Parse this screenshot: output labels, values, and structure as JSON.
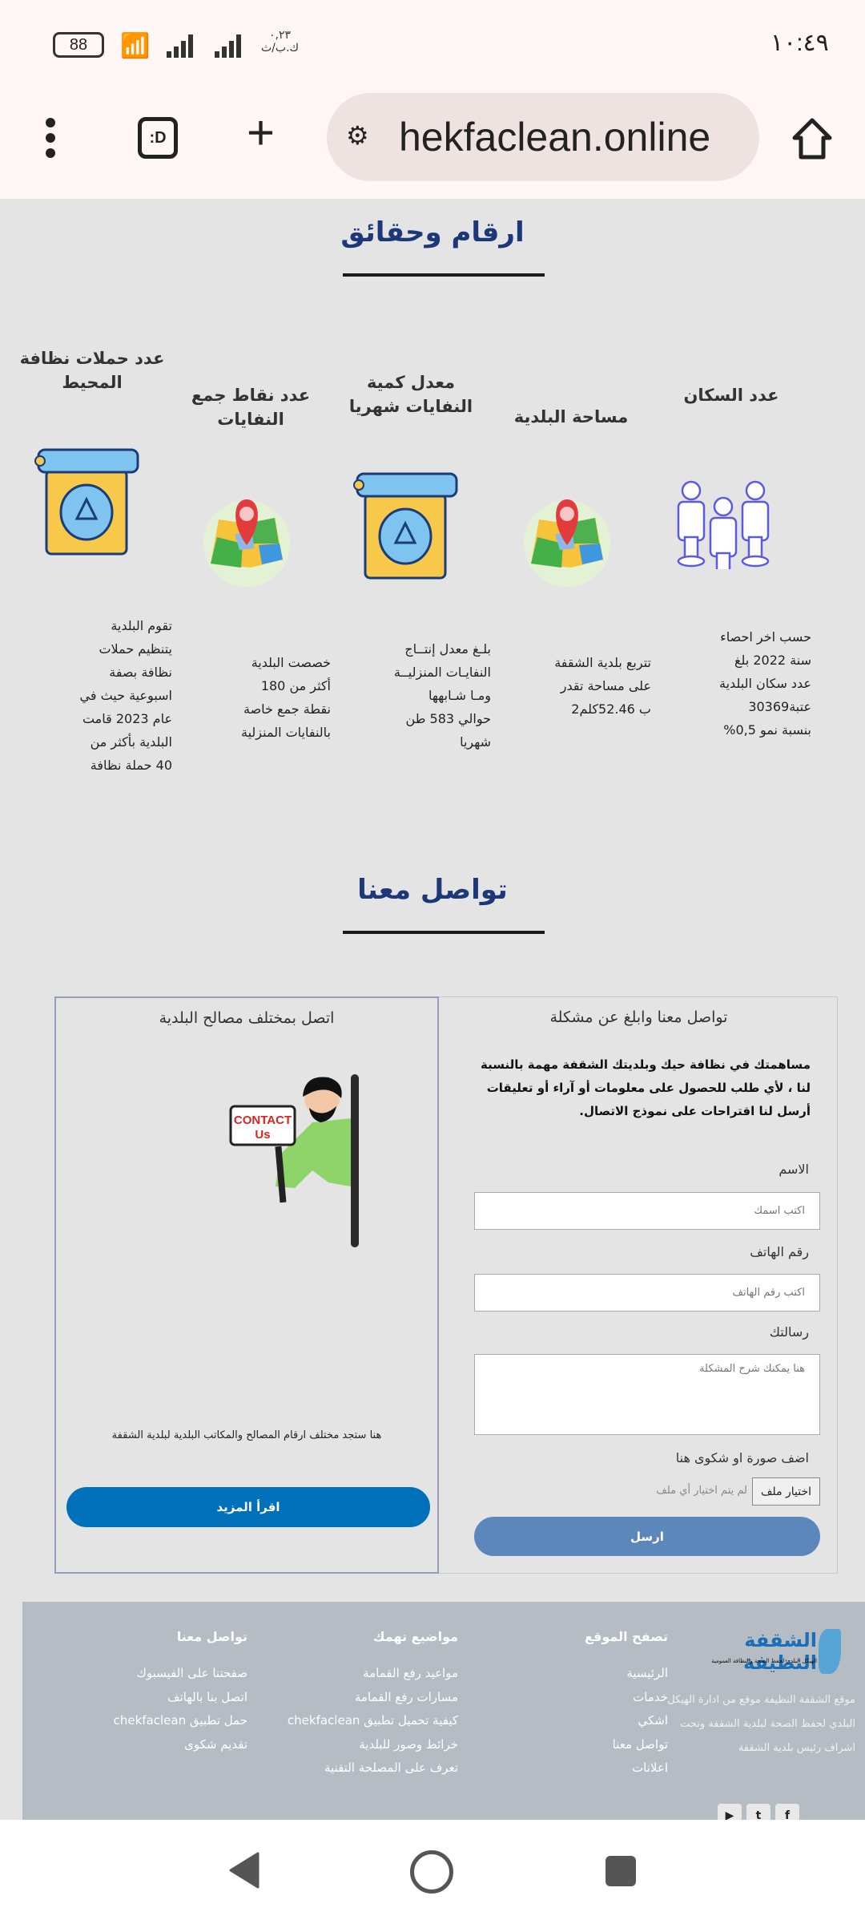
{
  "status_bar": {
    "time": "١٠:٤٩",
    "battery": "88",
    "data_speed": "٠,٢٣",
    "data_unit": "ك.ب/ث"
  },
  "browser": {
    "url": "hekfaclean.online"
  },
  "facts": {
    "title": "ارقام وحقائق",
    "items": [
      {
        "title": "عدد السكان",
        "icon": "people-icon",
        "lines": [
          "حسب اخر احصاء",
          "سنة   2022   بلغ",
          "عدد سكان البلدية",
          "عتبة30369",
          "بنسبة نمو 0,5%"
        ]
      },
      {
        "title": "مساحة البلدية",
        "icon": "map-pin-icon",
        "lines": [
          "تتربع بلدية الشقفة",
          "على مساحة تقدر",
          "ب 52.46كلم2"
        ]
      },
      {
        "title": "معدل كمية النفايات شهريا",
        "icon": "recycle-bin-icon",
        "lines": [
          "بلـغ معدل إنتــاج",
          "النفايـات المنزليــة",
          "ومـا شـابهها",
          "حوالي 583 طن",
          "شهريا"
        ]
      },
      {
        "title": "عدد نقاط جمع النفايات",
        "icon": "map-pin-icon",
        "lines": [
          "خصصت البلدية",
          "أكثر من 180",
          "نقطة جمع خاصة",
          "بالنفايات المنزلية"
        ]
      },
      {
        "title": "عدد حملات نظافة المحيط",
        "icon": "recycle-bin-icon",
        "lines": [
          "تقوم البلدية",
          "يتنظيم حملات",
          "نظافة بصفة",
          "اسبوعية حيث في",
          "عام 2023 قامت",
          "البلدية  بأكثر من",
          "40 حملة نظافة"
        ]
      }
    ]
  },
  "contact": {
    "title": "تواصل معنا",
    "form": {
      "title": "تواصل معنا وابلغ عن مشكلة",
      "intro": "مساهمتك في نظافة حيك وبلديتك الشقفة  مهمة بالنسبة لنا ، لأي طلب للحصول على معلومات أو آراء أو تعليقات أرسل لنا اقتراحات على نموذج الاتصال.",
      "name_label": "الاسم",
      "name_placeholder": "اكتب اسمك",
      "phone_label": "رقم الهاتف",
      "phone_placeholder": "اكتب رقم الهاتف",
      "message_label": "رسالتك",
      "message_placeholder": "هنا يمكنك شرح المشكلة",
      "file_label": "اضف صورة او شكوى هنا",
      "file_button": "اختيار ملف",
      "file_status": "لم يتم اختيار أي ملف",
      "submit": "ارسل"
    },
    "offices": {
      "title": "اتصل بمختلف مصالح البلدية",
      "sign_line1": "CONTACT",
      "sign_line2": "Us",
      "text": "هنا ستجد مختلف ارقام المصالح والمكاتب البلدية لبلدية الشقفة",
      "button": "اقرأ المزيد"
    }
  },
  "footer": {
    "logo_text": "الشقفة النظيفة",
    "logo_sub": "الهيكل البلدي لحفظ الصحة والنظافة العمومية",
    "about": [
      "موقع الشقفة النظيفة موقع من ادارة الهيكل",
      "البلدي لحفظ الصحة لبلدية الشقفة وتحت",
      "اشراف رئيس بلدية الشقفة"
    ],
    "columns": [
      {
        "title": "تصفح الموقع",
        "items": [
          "الرئيسية",
          "خدمات",
          "اشكي",
          "تواصل معنا",
          "اعلانات"
        ]
      },
      {
        "title": "مواضيع تهمك",
        "items": [
          "مواعيد رفع القمامة",
          "مسارات رفع القمامة",
          "كيفية تحميل تطبيق chekfaclean",
          "خرائط وصور للبلدية",
          "تعرف على المصلحة التقنية"
        ]
      },
      {
        "title": "تواصل معنا",
        "items": [
          "صفحتنا على الفيسبوك",
          "اتصل بنا بالهاتف",
          "حمل تطبيق chekfaclean",
          "تقديم شكوى"
        ]
      }
    ],
    "social": [
      "facebook-icon",
      "twitter-icon",
      "youtube-icon"
    ]
  },
  "colors": {
    "heading": "#1c3879",
    "read_more": "#0070bb",
    "submit": "#5b87bb",
    "footer_bg": "#b6bcc3"
  }
}
